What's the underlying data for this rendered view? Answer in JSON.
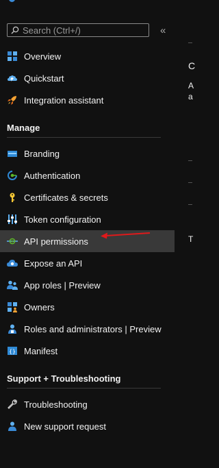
{
  "search": {
    "placeholder": "Search (Ctrl+/)"
  },
  "nav": {
    "top": [
      {
        "label": "Overview",
        "icon": "overview-icon"
      },
      {
        "label": "Quickstart",
        "icon": "quickstart-icon"
      },
      {
        "label": "Integration assistant",
        "icon": "rocket-icon"
      }
    ],
    "manage_title": "Manage",
    "manage": [
      {
        "label": "Branding",
        "icon": "branding-icon"
      },
      {
        "label": "Authentication",
        "icon": "authentication-icon"
      },
      {
        "label": "Certificates & secrets",
        "icon": "key-icon"
      },
      {
        "label": "Token configuration",
        "icon": "token-config-icon"
      },
      {
        "label": "API permissions",
        "icon": "api-permissions-icon",
        "active": true
      },
      {
        "label": "Expose an API",
        "icon": "cloud-icon"
      },
      {
        "label": "App roles | Preview",
        "icon": "app-roles-icon"
      },
      {
        "label": "Owners",
        "icon": "owners-icon"
      },
      {
        "label": "Roles and administrators | Preview",
        "icon": "roles-admin-icon"
      },
      {
        "label": "Manifest",
        "icon": "manifest-icon"
      }
    ],
    "support_title": "Support + Troubleshooting",
    "support": [
      {
        "label": "Troubleshooting",
        "icon": "wrench-icon"
      },
      {
        "label": "New support request",
        "icon": "support-person-icon"
      }
    ]
  },
  "right_pane": {
    "letters": [
      "C",
      "A",
      "a",
      "T"
    ]
  },
  "colors": {
    "background": "#111111",
    "active_item": "#393939",
    "arrow": "#e0191b",
    "accent_blue": "#3a8ad6"
  }
}
